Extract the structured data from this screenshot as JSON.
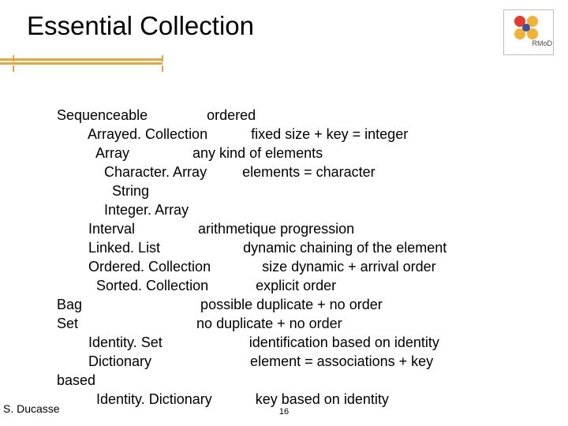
{
  "title": "Essential Collection",
  "logo_label": "RMoD",
  "body_text": "Sequenceable               ordered\n        Arrayed. Collection           fixed size + key = integer\n          Array                any kind of elements\n            Character. Array         elements = character\n              String\n            Integer. Array\n        Interval                arithmetique progression\n        Linked. List                     dynamic chaining of the element\n        Ordered. Collection             size dynamic + arrival order\n          Sorted. Collection            explicit order\nBag                              possible duplicate + no order\nSet                              no duplicate + no order\n        Identity. Set                      identification based on identity\n        Dictionary                         element = associations + key\nbased\n          Identity. Dictionary           key based on identity",
  "footer_author": "S. Ducasse",
  "footer_page": "16"
}
